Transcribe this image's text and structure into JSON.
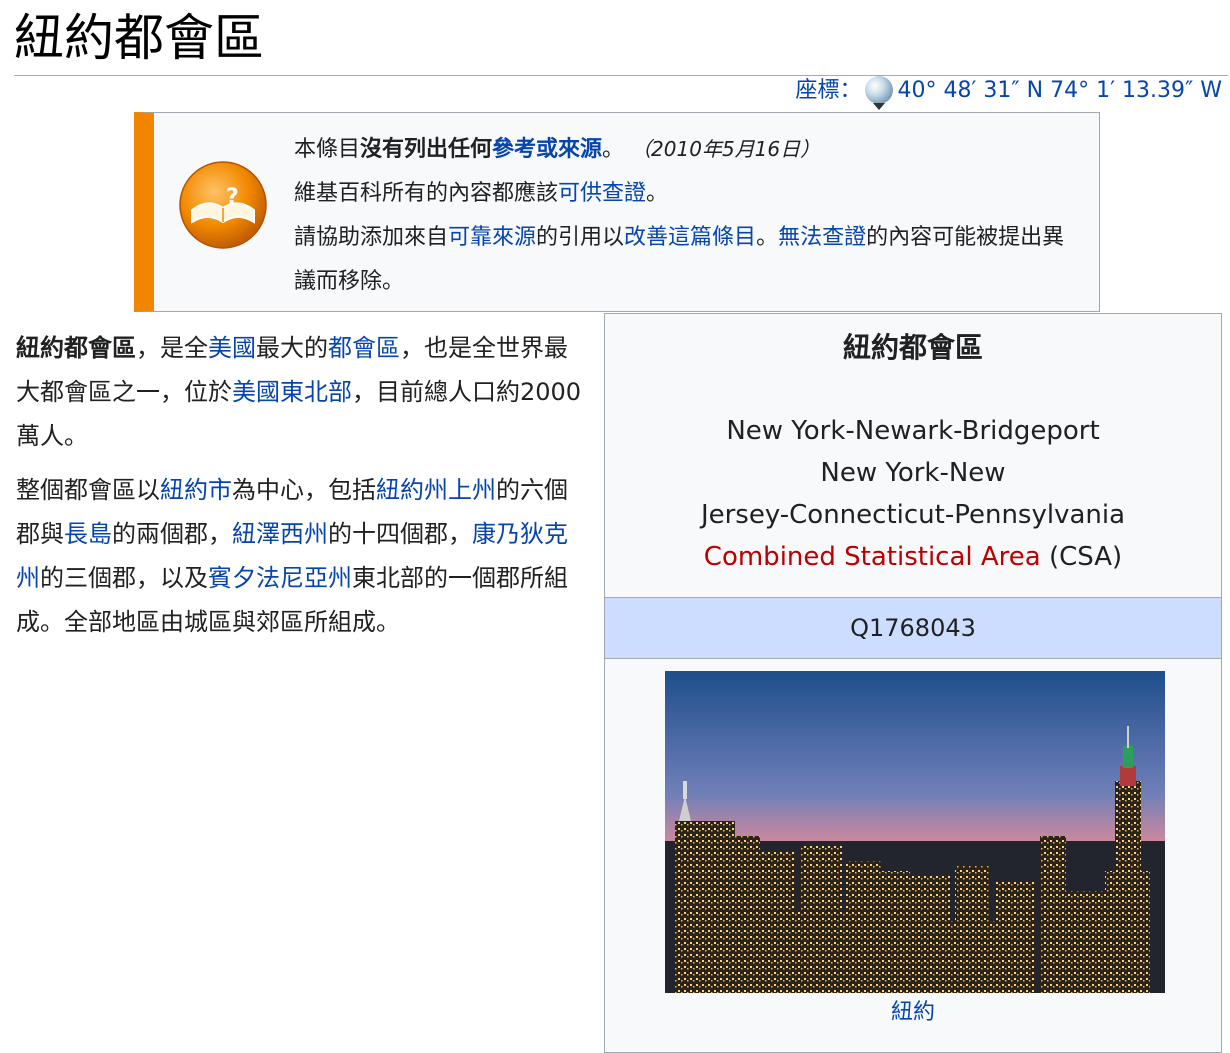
{
  "page": {
    "title": "紐約都會區"
  },
  "coordinates": {
    "label": "座標",
    "separator": "：",
    "value": "40° 48′ 31″ N 74° 1′ 13.39″ W"
  },
  "ambox": {
    "line1_prefix": "本條目",
    "line1_bold": "沒有列出任何",
    "line1_link": "參考或來源",
    "line1_suffix": "。",
    "line1_date": "（2010年5月16日）",
    "line2_prefix": "維基百科所有的內容都應該",
    "line2_link": "可供查證",
    "line2_suffix": "。",
    "line3_prefix": "請協助添加來自",
    "line3_link1": "可靠來源",
    "line3_mid1": "的引用以",
    "line3_link2": "改善這篇條目",
    "line3_mid2": "。",
    "line3_link3": "無法查證",
    "line3_suffix": "的內容可能被提出異議而移除。"
  },
  "lead": {
    "p1": {
      "bold": "紐約都會區",
      "t1": "，是全",
      "l1": "美國",
      "t2": "最大的",
      "l2": "都會區",
      "t3": "，也是全世界最大都會區之一，位於",
      "l3": "美國東北部",
      "t4": "，目前總人口約2000萬人。"
    },
    "p2": {
      "t1": "整個都會區以",
      "l1": "紐約市",
      "t2": "為中心，包括",
      "l2": "紐約州",
      "l3": "上州",
      "t3": "的六個郡與",
      "l4": "長島",
      "t4": "的兩個郡，",
      "l5": "紐澤西州",
      "t5": "的十四個郡，",
      "l6": "康乃狄克州",
      "t6": "的三個郡，以及",
      "l7": "賓夕法尼亞州",
      "t7": "東北部的一個郡所組成。全部地區由城區與郊區所組成。"
    }
  },
  "infobox": {
    "title": "紐約都會區",
    "subtitle_line1": "New York-Newark-Bridgeport",
    "subtitle_line2": "New York-New",
    "subtitle_line3": "Jersey-Connecticut-Pennsylvania",
    "subtitle_redlink": "Combined Statistical Area",
    "subtitle_suffix": " (CSA)",
    "qid": "Q1768043",
    "image_caption": "紐約"
  },
  "colors": {
    "link": "#0645ad",
    "redlink": "#ba0000",
    "ambox_border": "#f28500",
    "infobox_header": "#ccddff"
  }
}
